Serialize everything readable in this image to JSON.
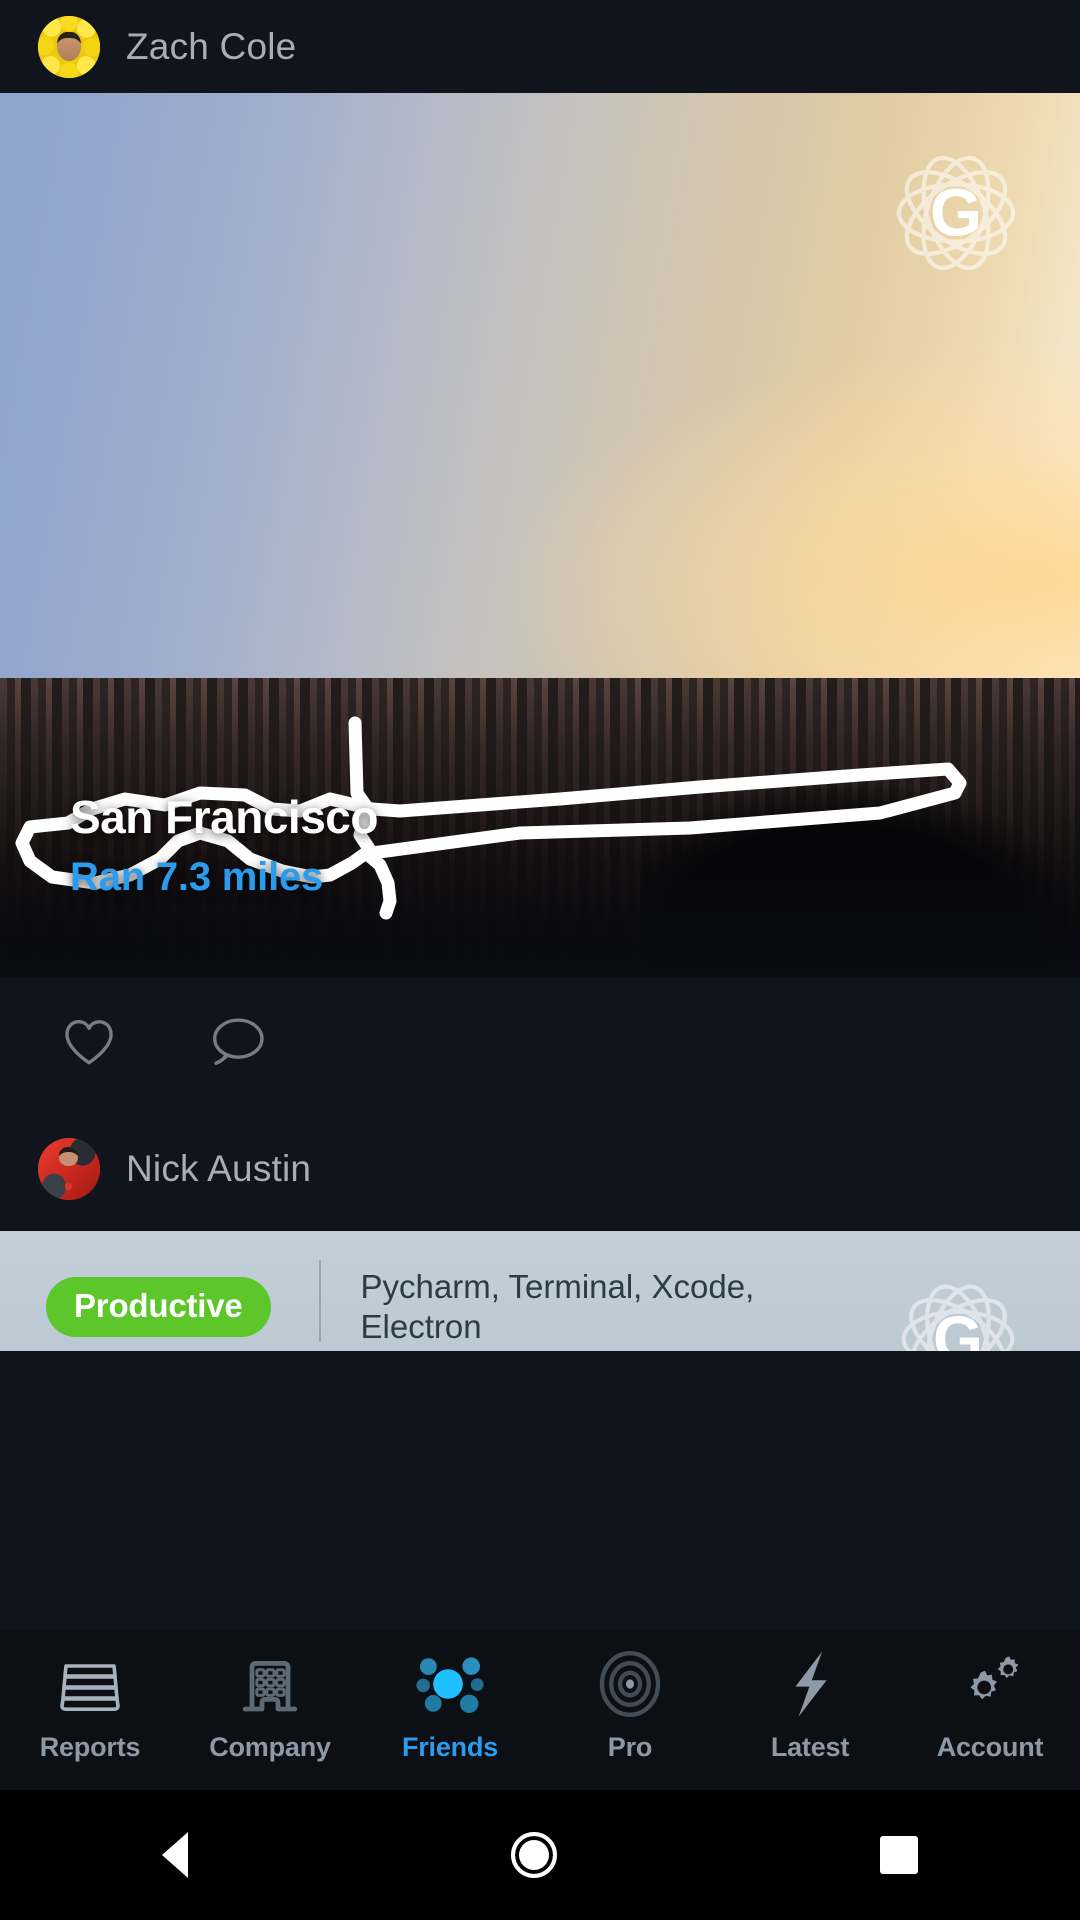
{
  "app": {
    "brand_letter": "G",
    "brand_icon": "atom-logo",
    "background_color": "#10141c",
    "accent_color": "#2b9ced",
    "badge_color": "#5dc62b"
  },
  "feed": {
    "posts": [
      {
        "author": {
          "name": "Zach Cole",
          "avatar": "zach-cole-avatar"
        },
        "media": {
          "type": "photo-with-route",
          "route_overlay": "gps-run-route",
          "watermark": "atom-logo",
          "caption_title": "San Francisco",
          "caption_subtitle": "Ran 7.3 miles",
          "activity": "Ran",
          "distance": "7.3",
          "distance_unit": "miles",
          "location": "San Francisco"
        },
        "actions": [
          {
            "name": "like",
            "icon": "heart-icon"
          },
          {
            "name": "comment",
            "icon": "comment-icon"
          }
        ]
      },
      {
        "author": {
          "name": "Nick Austin",
          "avatar": "nick-austin-avatar"
        },
        "body": {
          "badge_label": "Productive",
          "apps_line1": "Pycharm, Terminal, Xcode,",
          "apps_line2": "Electron",
          "watermark": "atom-logo"
        }
      }
    ]
  },
  "tabbar": {
    "items": [
      {
        "label": "Reports",
        "icon": "stacked-layers-icon",
        "active": false
      },
      {
        "label": "Company",
        "icon": "building-icon",
        "active": false
      },
      {
        "label": "Friends",
        "icon": "people-cluster-icon",
        "active": true
      },
      {
        "label": "Pro",
        "icon": "target-icon",
        "active": false
      },
      {
        "label": "Latest",
        "icon": "lightning-bolt-icon",
        "active": false
      },
      {
        "label": "Account",
        "icon": "gears-icon",
        "active": false
      }
    ]
  },
  "system_nav": {
    "back": "back-triangle",
    "home": "home-circle",
    "recents": "recents-square"
  }
}
